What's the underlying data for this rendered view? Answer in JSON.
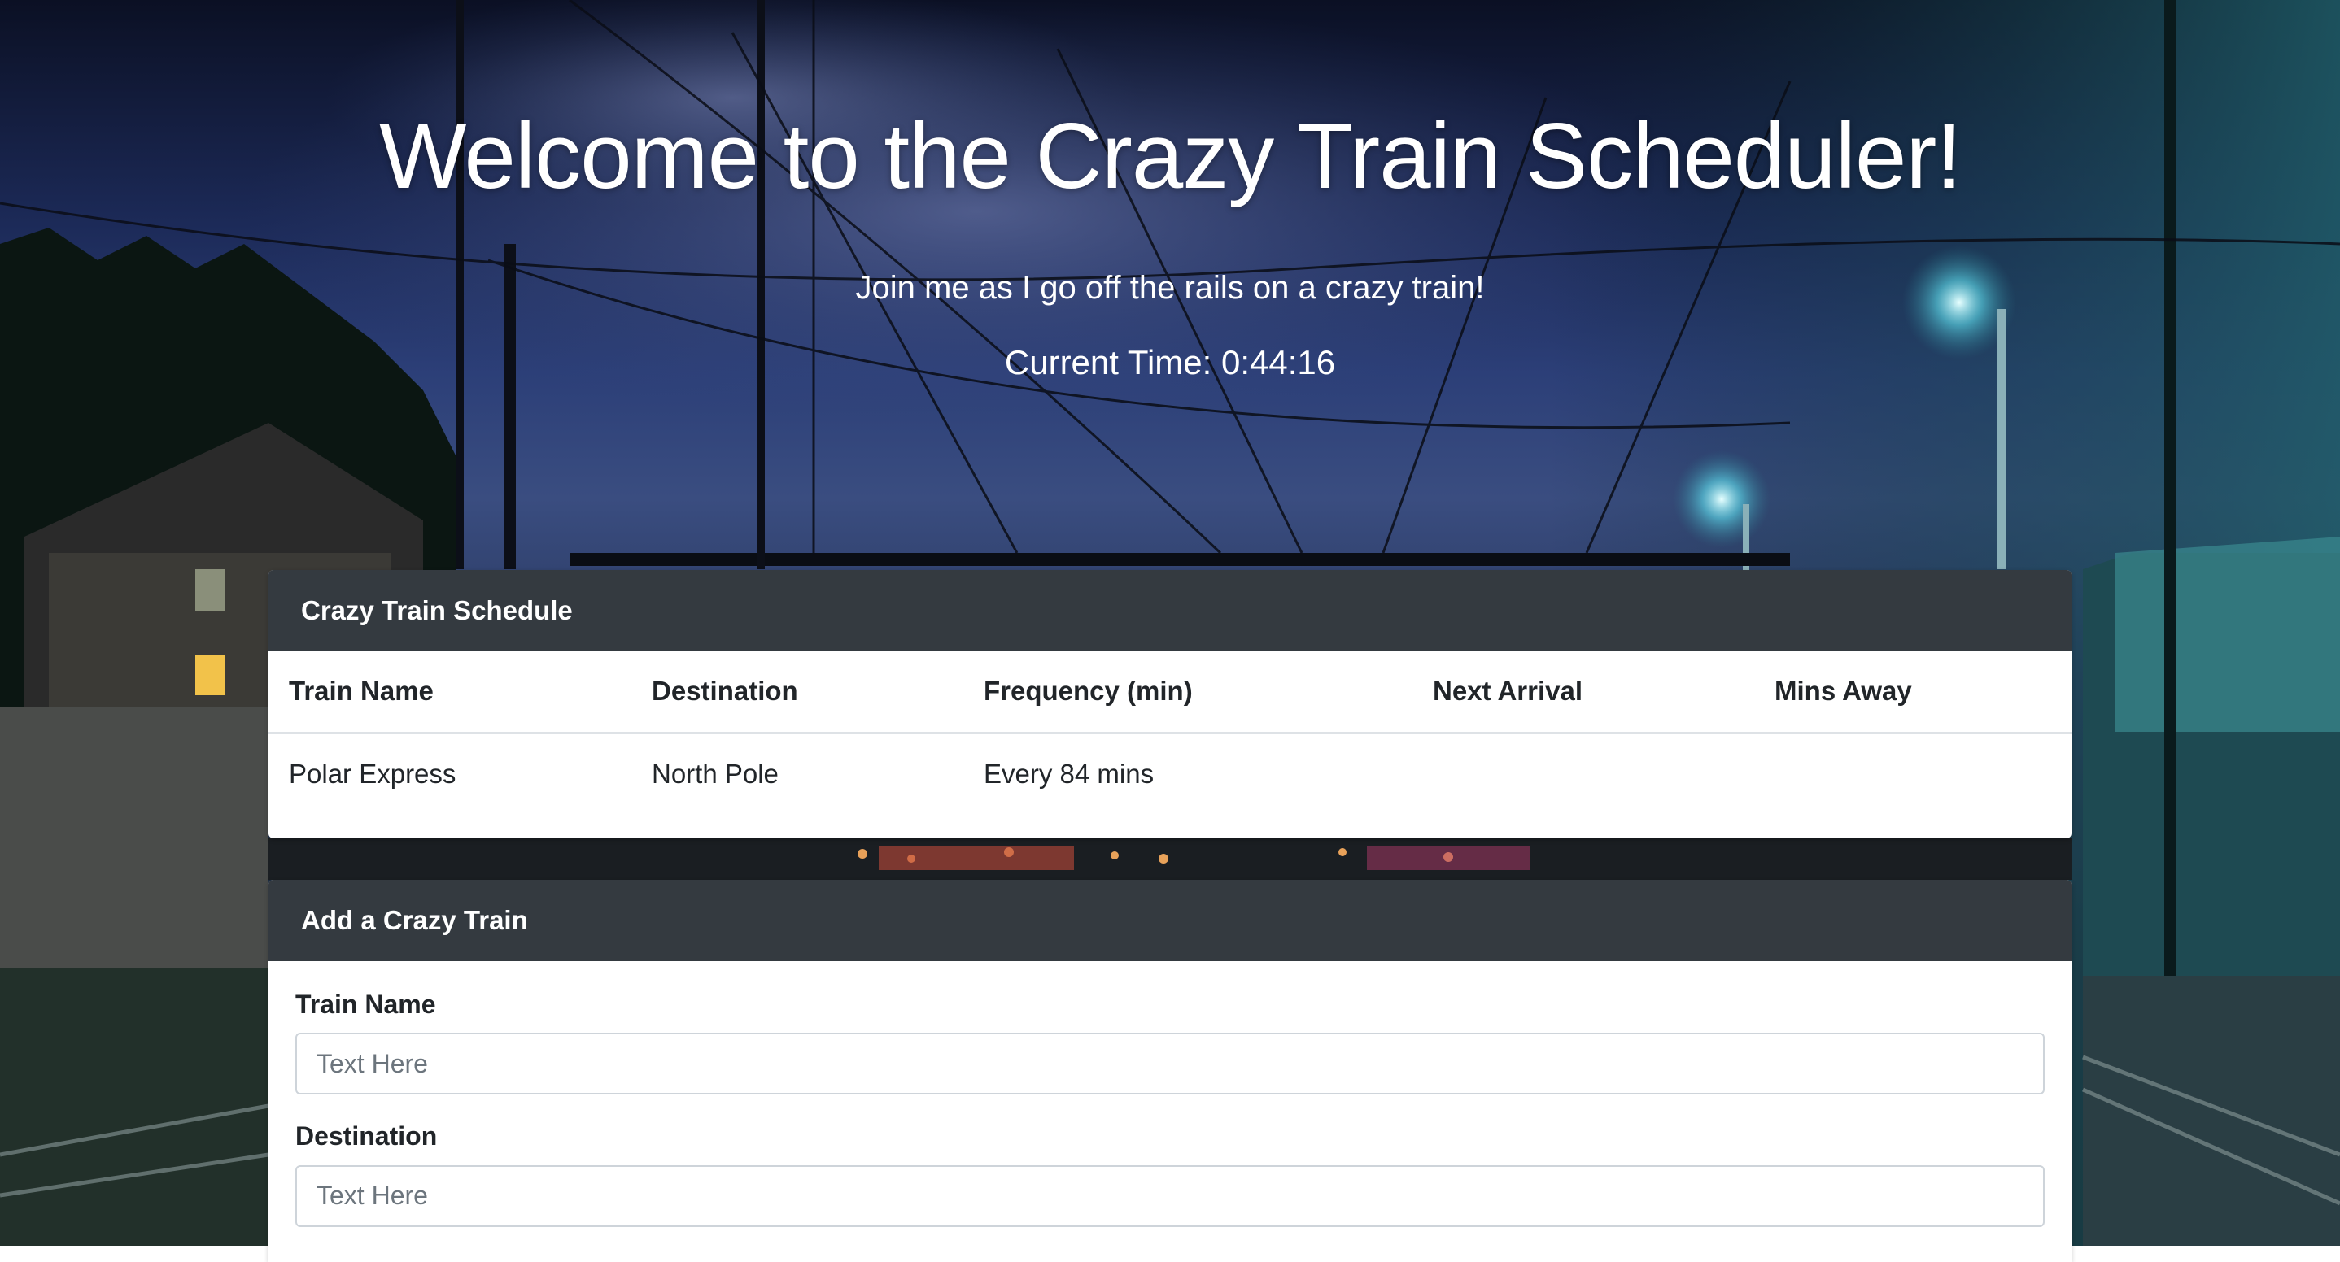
{
  "hero": {
    "title": "Welcome to the Crazy Train Scheduler!",
    "subtitle": "Join me as I go off the rails on a crazy train!",
    "current_time": "Current Time: 0:44:16"
  },
  "schedule": {
    "header": "Crazy Train Schedule",
    "columns": [
      "Train Name",
      "Destination",
      "Frequency (min)",
      "Next Arrival",
      "Mins Away"
    ],
    "rows": [
      {
        "name": "Polar Express",
        "destination": "North Pole",
        "frequency": "Every 84 mins",
        "next_arrival": "",
        "mins_away": ""
      }
    ]
  },
  "add_train": {
    "header": "Add a Crazy Train",
    "fields": [
      {
        "label": "Train Name",
        "placeholder": "Text Here"
      },
      {
        "label": "Destination",
        "placeholder": "Text Here"
      }
    ]
  },
  "colors": {
    "card_header": "#343a40",
    "text": "#212529",
    "input_border": "#ced4da"
  }
}
